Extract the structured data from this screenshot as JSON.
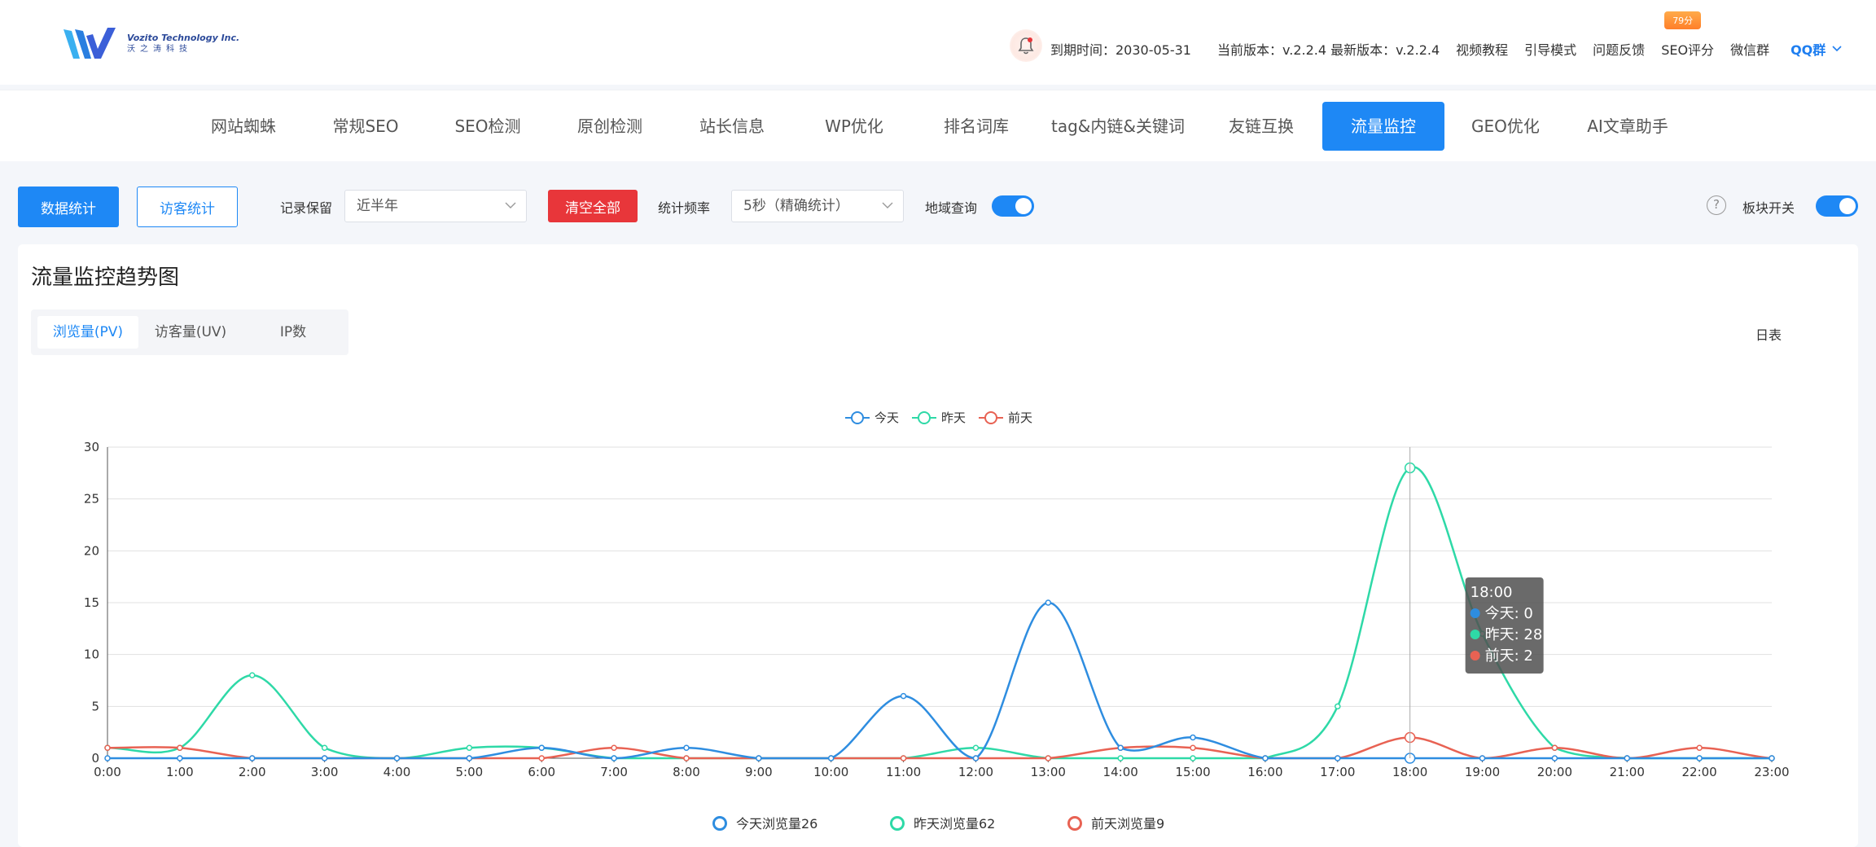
{
  "brand": {
    "name_en": "Vozito Technology Inc.",
    "name_cn": "沃之涛科技",
    "colors": {
      "primary": "#1e88f5",
      "danger": "#e8363a",
      "badge": "#ff8f35"
    }
  },
  "header": {
    "expiry": "到期时间：2030-05-31",
    "version": "当前版本：v.2.2.4 最新版本：v.2.2.4",
    "links": [
      "视频教程",
      "引导模式",
      "问题反馈",
      "SEO评分",
      "微信群"
    ],
    "seo_badge": "79分",
    "qq": "QQ群"
  },
  "nav": {
    "items": [
      "网站蜘蛛",
      "常规SEO",
      "SEO检测",
      "原创检测",
      "站长信息",
      "WP优化",
      "排名词库",
      "tag&内链&关键词",
      "友链互换",
      "流量监控",
      "GEO优化",
      "AI文章助手"
    ],
    "active": "流量监控"
  },
  "toolbar": {
    "data_stats": "数据统计",
    "visitor_stats": "访客统计",
    "record_label": "记录保留",
    "record_value": "近半年",
    "clear_all": "清空全部",
    "freq_label": "统计频率",
    "freq_value": "5秒（精确统计）",
    "region_label": "地域查询",
    "region_on": true,
    "block_label": "板块开关",
    "block_on": true
  },
  "card": {
    "title": "流量监控趋势图",
    "tabs": [
      "浏览量(PV)",
      "访客量(UV)",
      "IP数"
    ],
    "active_tab": "浏览量(PV)",
    "report": "日表"
  },
  "chart_data": {
    "type": "line",
    "x": [
      "0:00",
      "1:00",
      "2:00",
      "3:00",
      "4:00",
      "5:00",
      "6:00",
      "7:00",
      "8:00",
      "9:00",
      "10:00",
      "11:00",
      "12:00",
      "13:00",
      "14:00",
      "15:00",
      "16:00",
      "17:00",
      "18:00",
      "19:00",
      "20:00",
      "21:00",
      "22:00",
      "23:00"
    ],
    "ylim": [
      0,
      30
    ],
    "yticks": [
      0,
      5,
      10,
      15,
      20,
      25,
      30
    ],
    "smooth": true,
    "grid": true,
    "legend_position": "top-center",
    "series": [
      {
        "name": "今天",
        "color": "#2e8de0",
        "values": [
          0,
          0,
          0,
          0,
          0,
          0,
          1,
          0,
          1,
          0,
          0,
          6,
          0,
          15,
          1,
          2,
          0,
          0,
          0,
          0,
          0,
          0,
          0,
          0
        ]
      },
      {
        "name": "昨天",
        "color": "#2ed9a7",
        "values": [
          1,
          1,
          8,
          1,
          0,
          1,
          1,
          0,
          0,
          0,
          0,
          0,
          1,
          0,
          0,
          0,
          0,
          5,
          28,
          12,
          1,
          0,
          0,
          0
        ]
      },
      {
        "name": "前天",
        "color": "#e86253",
        "values": [
          1,
          1,
          0,
          0,
          0,
          0,
          0,
          1,
          0,
          0,
          0,
          0,
          0,
          0,
          1,
          1,
          0,
          0,
          2,
          0,
          1,
          0,
          1,
          0
        ]
      }
    ],
    "tooltip": {
      "x": "18:00",
      "items": [
        {
          "label": "今天: 0",
          "color": "#2e8de0"
        },
        {
          "label": "昨天: 28",
          "color": "#2ed9a7"
        },
        {
          "label": "前天: 2",
          "color": "#e86253"
        }
      ]
    },
    "totals": [
      {
        "label": "今天浏览量26",
        "color": "#2e8de0"
      },
      {
        "label": "昨天浏览量62",
        "color": "#2ed9a7"
      },
      {
        "label": "前天浏览量9",
        "color": "#e86253"
      }
    ]
  }
}
